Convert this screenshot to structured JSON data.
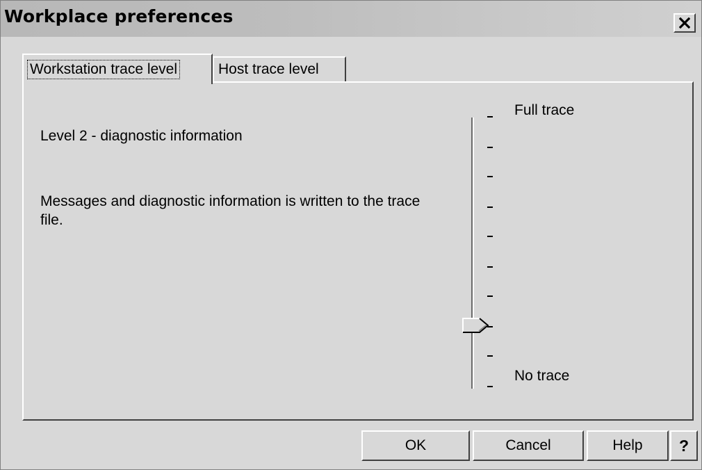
{
  "window": {
    "title": "Workplace preferences"
  },
  "tabs": [
    {
      "label": "Workstation trace level",
      "active": true
    },
    {
      "label": "Host trace level",
      "active": false
    }
  ],
  "panel": {
    "level_title": "Level 2 - diagnostic information",
    "level_description": "Messages and diagnostic information is written to the trace file."
  },
  "slider": {
    "top_label": "Full trace",
    "bottom_label": "No trace",
    "min": 0,
    "max": 9,
    "value": 2,
    "orientation": "vertical"
  },
  "buttons": {
    "ok": "OK",
    "cancel": "Cancel",
    "help": "Help",
    "context_help": "?"
  },
  "icons": {
    "close": "close-icon"
  },
  "colors": {
    "background": "#d8d8d8",
    "shadow": "#404040",
    "highlight": "#ffffff"
  }
}
